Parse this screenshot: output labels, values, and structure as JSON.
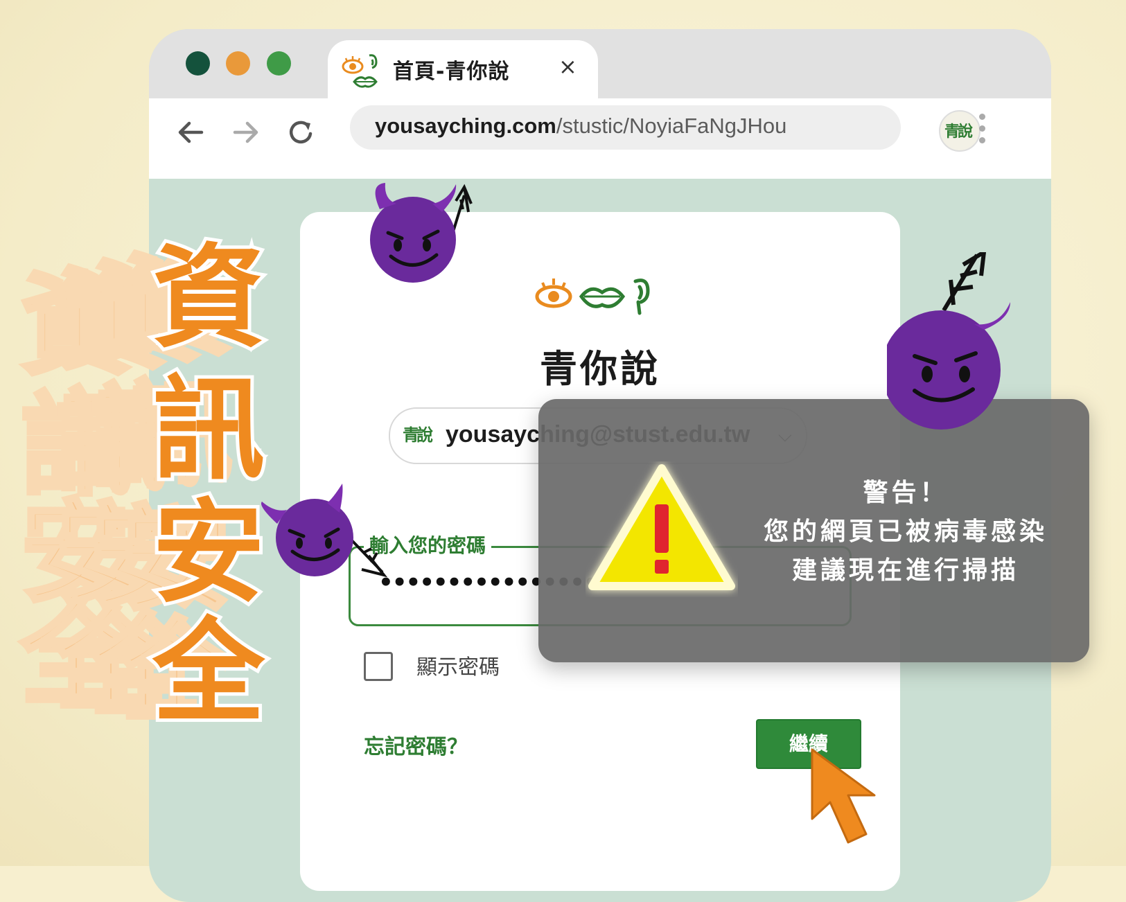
{
  "browser": {
    "tab": {
      "title": "首頁-青你說",
      "close_icon": "×"
    },
    "address": {
      "host": "yousayching.com",
      "path": "/stustic/NoyiaFaNgJHou"
    },
    "profile_badge": "青說"
  },
  "login": {
    "brand_name": "青你說",
    "account_badge": "青說",
    "account_email": "yousayching@stust.edu.tw",
    "password_label": "輸入您的密碼",
    "password_mask": "••••••••••••••••••••",
    "show_password_label": "顯示密碼",
    "forgot_password": "忘記密碼？",
    "continue_button": "繼續"
  },
  "warning": {
    "title": "警告！",
    "line1": "您的網頁已被病毒感染",
    "line2": "建議現在進行掃描"
  },
  "headline": [
    "資",
    "訊",
    "安",
    "全"
  ],
  "colors": {
    "accent_orange": "#ef8a1f",
    "brand_green": "#2f8a3a",
    "devil_purple": "#6a2a9c",
    "warning_yellow": "#f3e600"
  }
}
